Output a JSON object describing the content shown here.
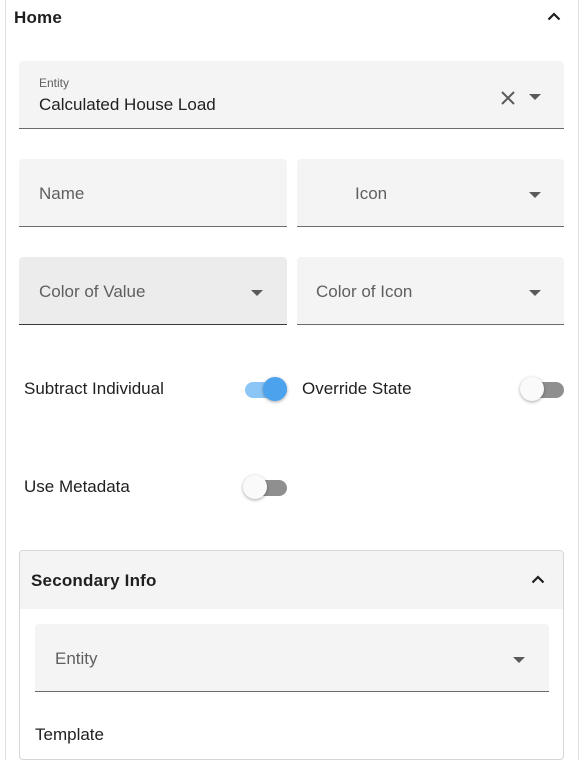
{
  "home": {
    "title": "Home"
  },
  "entity": {
    "label": "Entity",
    "value": "Calculated House Load"
  },
  "name_field": {
    "label": "Name"
  },
  "icon_field": {
    "label": "Icon"
  },
  "color_value": {
    "label": "Color of Value"
  },
  "color_icon": {
    "label": "Color of Icon"
  },
  "toggles": {
    "subtract_individual": {
      "label": "Subtract Individual",
      "state": "on"
    },
    "override_state": {
      "label": "Override State",
      "state": "off"
    },
    "use_metadata": {
      "label": "Use Metadata",
      "state": "off"
    }
  },
  "secondary_info": {
    "title": "Secondary Info",
    "entity_label": "Entity",
    "template_label": "Template"
  },
  "colors": {
    "accent": "#4aa3ec",
    "accent_track": "#8cc6f7"
  }
}
